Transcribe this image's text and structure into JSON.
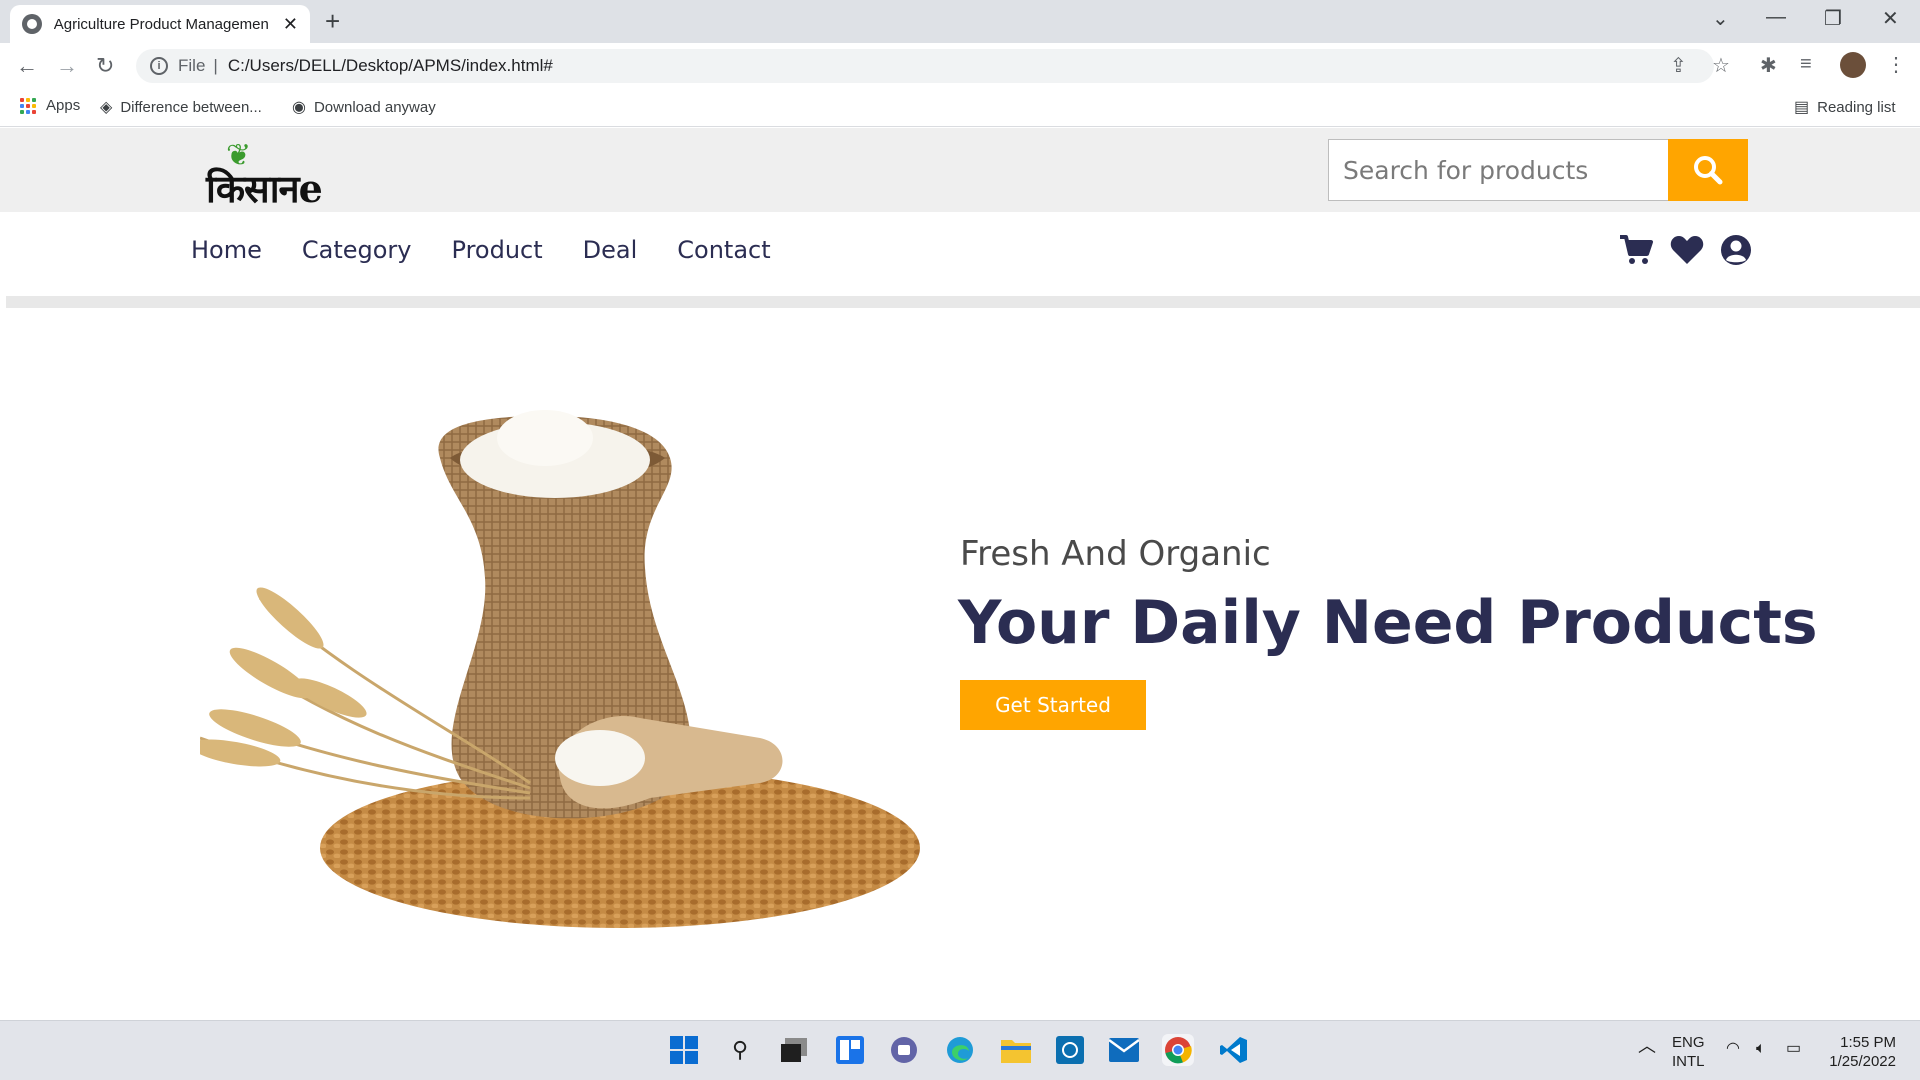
{
  "browser": {
    "tab_title": "Agriculture Product Managemen",
    "tab_close": "✕",
    "new_tab": "+",
    "url_scheme": "File",
    "url_sep": "|",
    "url": "C:/Users/DELL/Desktop/APMS/index.html#",
    "bookmarks": [
      "Apps",
      "Difference between...",
      "Download anyway"
    ],
    "reading_list": "Reading list"
  },
  "site": {
    "logo_text": "किसानe",
    "search_placeholder": "Search for products",
    "nav": [
      "Home",
      "Category",
      "Product",
      "Deal",
      "Contact"
    ],
    "hero_subtitle": "Fresh And Organic",
    "hero_title": "Your Daily Need Products",
    "hero_button": "Get Started",
    "accent": "#ffa500",
    "navy": "#2b2d52"
  },
  "taskbar": {
    "lang": "ENG",
    "layout": "INTL",
    "time": "1:55 PM",
    "date": "1/25/2022"
  }
}
